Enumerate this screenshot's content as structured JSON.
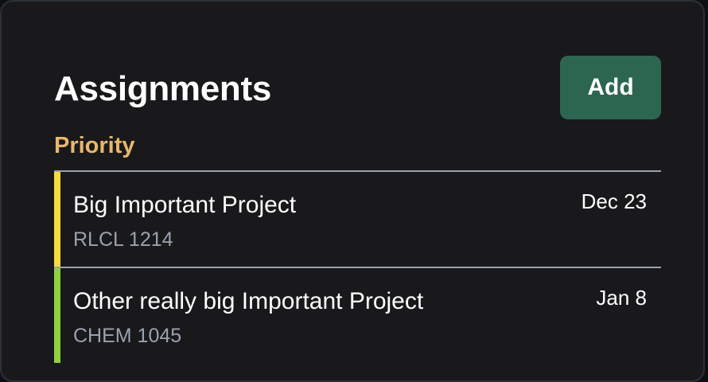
{
  "header": {
    "title": "Assignments",
    "add_label": "Add"
  },
  "section": {
    "label": "Priority"
  },
  "assignments": [
    {
      "name": "Big Important Project",
      "course": "RLCL 1214",
      "date": "Dec 23",
      "accent_color": "#f5dc3c"
    },
    {
      "name": "Other really big Important Project",
      "course": "CHEM 1045",
      "date": "Jan 8",
      "accent_color": "#8fd13f"
    }
  ],
  "colors": {
    "card_bg": "#19191b",
    "add_button_bg": "#2c6650",
    "section_label": "#e8b66d",
    "divider": "#9aa0ad",
    "muted_text": "#9ba1ad"
  }
}
